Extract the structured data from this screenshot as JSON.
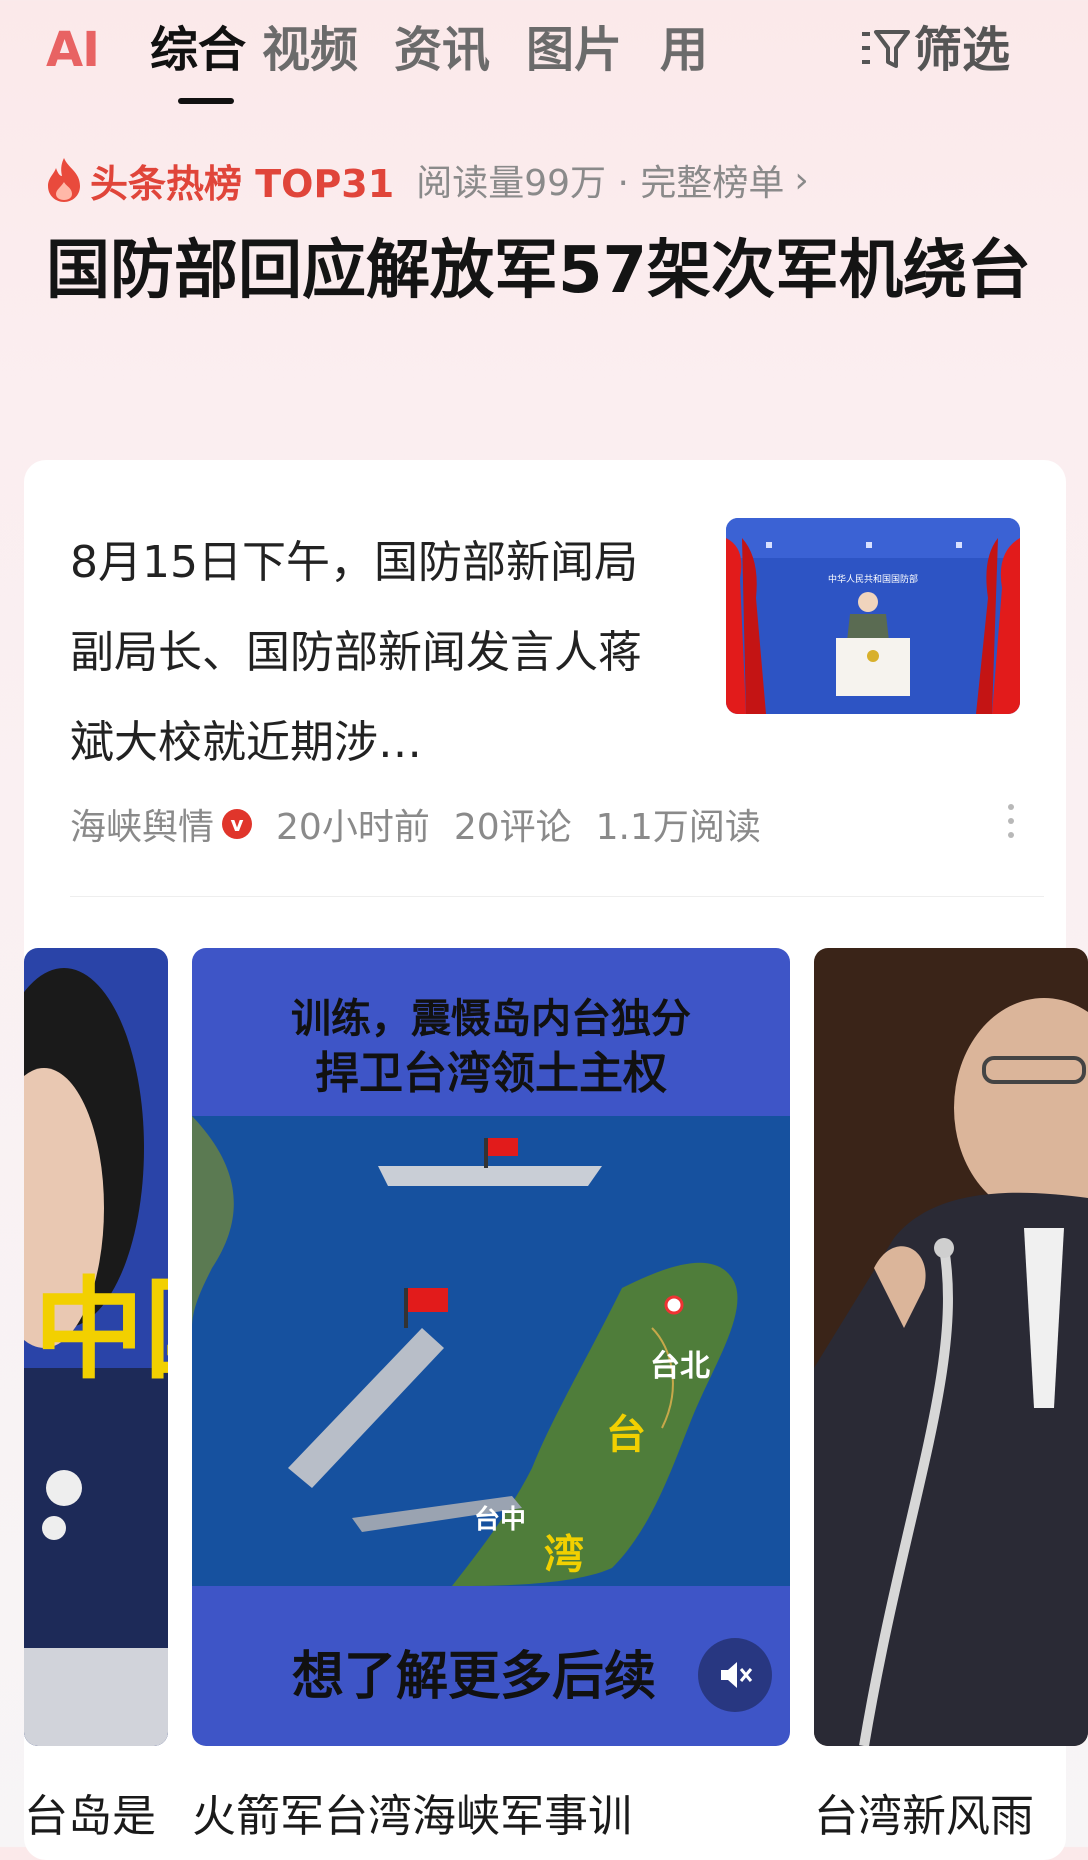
{
  "tabs": {
    "ai_label": "AI",
    "items": [
      "综合",
      "视频",
      "资讯",
      "图片",
      "用"
    ],
    "active_index": 0,
    "filter_label": "筛选"
  },
  "hot_list": {
    "title": "头条热榜 TOP31",
    "meta": "阅读量99万 · 完整榜单",
    "chevron": "›"
  },
  "headline": "国防部回应解放军57架次军机绕台",
  "article": {
    "summary": "8月15日下午，国防部新闻局副局长、国防部新闻发言人蒋斌大校就近期涉…",
    "source": "海峡舆情",
    "badge": "v",
    "time": "20小时前",
    "comments": "20评论",
    "reads": "1.1万阅读",
    "thumb_banner": "中华人民共和国国防部"
  },
  "videos": [
    {
      "caption": "台岛是",
      "overlay": "中国"
    },
    {
      "caption": "火箭军台湾海峡军事训",
      "overlay_top": "训练，震慑岛内台独分",
      "overlay_mid": "捍卫台湾领土主权",
      "overlay_bottom": "想了解更多后续",
      "map_labels": [
        "台北",
        "台",
        "台中",
        "湾"
      ]
    },
    {
      "caption": "台湾新风雨"
    }
  ],
  "colors": {
    "accent_red": "#e0453a",
    "active_tab": "#111111",
    "muted_text": "#8a8a8a"
  }
}
